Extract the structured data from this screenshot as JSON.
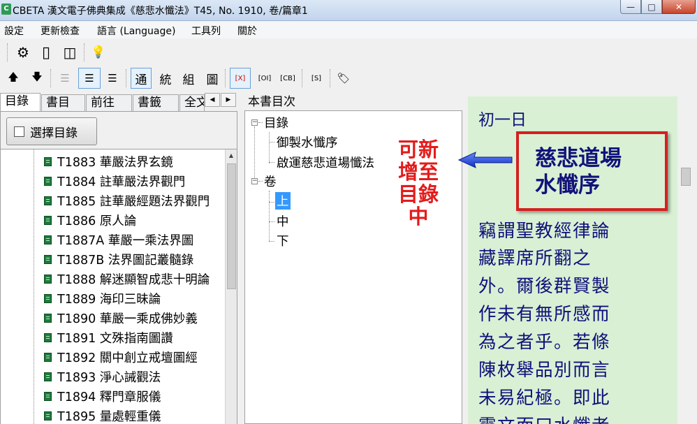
{
  "window": {
    "icon": "cbeta-app-icon",
    "title": "CBETA 漢文電子佛典集成《慈悲水懺法》T45, No. 1910, 卷/篇章1",
    "buttons": {
      "minimize": "—",
      "maximize": "□",
      "close": "✕"
    }
  },
  "menu": [
    "設定",
    "更新檢查",
    "語言 (Language)",
    "工具列",
    "關於"
  ],
  "toolbar1": {
    "icons": [
      "gear-icon",
      "single-pane-icon",
      "double-pane-icon",
      "lightbulb-icon"
    ],
    "glyphs": [
      "⚙",
      "▯",
      "◫",
      "💡"
    ]
  },
  "toolbar2": {
    "up": "🡅",
    "down": "🡇",
    "view_a": "☰",
    "view_b": "☰",
    "view_c": "☰",
    "tong": "通",
    "tong2": "統",
    "zu": "組",
    "tu": "圖",
    "x": "[X]",
    "oi": "[OI]",
    "cb": "[CB]",
    "s": "[S]",
    "tag": "🏷"
  },
  "tabs": [
    "目錄",
    "書目",
    "前往",
    "書籤",
    "全文"
  ],
  "tab_arrows": {
    "left": "◀",
    "right": "▶"
  },
  "left": {
    "select_button": "選擇目錄",
    "items": [
      "T1883 華嚴法界玄鏡",
      "T1884 註華嚴法界觀門",
      "T1885 註華嚴經題法界觀門",
      "T1886 原人論",
      "T1887A 華嚴一乘法界圖",
      "T1887B 法界圖記叢髓錄",
      "T1888 解迷顯智成悲十明論",
      "T1889 海印三昧論",
      "T1890 華嚴一乘成佛妙義",
      "T1891 文殊指南圖讚",
      "T1892 關中創立戒壇圖經",
      "T1893 淨心誡觀法",
      "T1894 釋門章服儀",
      "T1895 量處輕重儀"
    ]
  },
  "middle": {
    "title": "本書目次",
    "mulu": "目錄",
    "mulu_children": [
      "御製水懺序",
      "啟運慈悲道場懺法"
    ],
    "juan": "卷",
    "juan_children": [
      "上",
      "中",
      "下"
    ]
  },
  "annotation": {
    "lines": [
      "可新",
      "增至",
      "目錄",
      "中"
    ],
    "color": "#e31c1c"
  },
  "right": {
    "day": "初一日",
    "preface_title_1": "慈悲道場",
    "preface_title_2": "水懺序",
    "lines": [
      "竊謂聖教經律論",
      "藏譯席所翻之",
      "外。爾後群賢製",
      "作未有無所感而",
      "為之者乎。若條",
      "陳枚舉品別而言",
      "未易紀極。即此",
      "靈文而曰水懺者"
    ],
    "background": "#d9f0d5",
    "text_color": "#10107a"
  }
}
